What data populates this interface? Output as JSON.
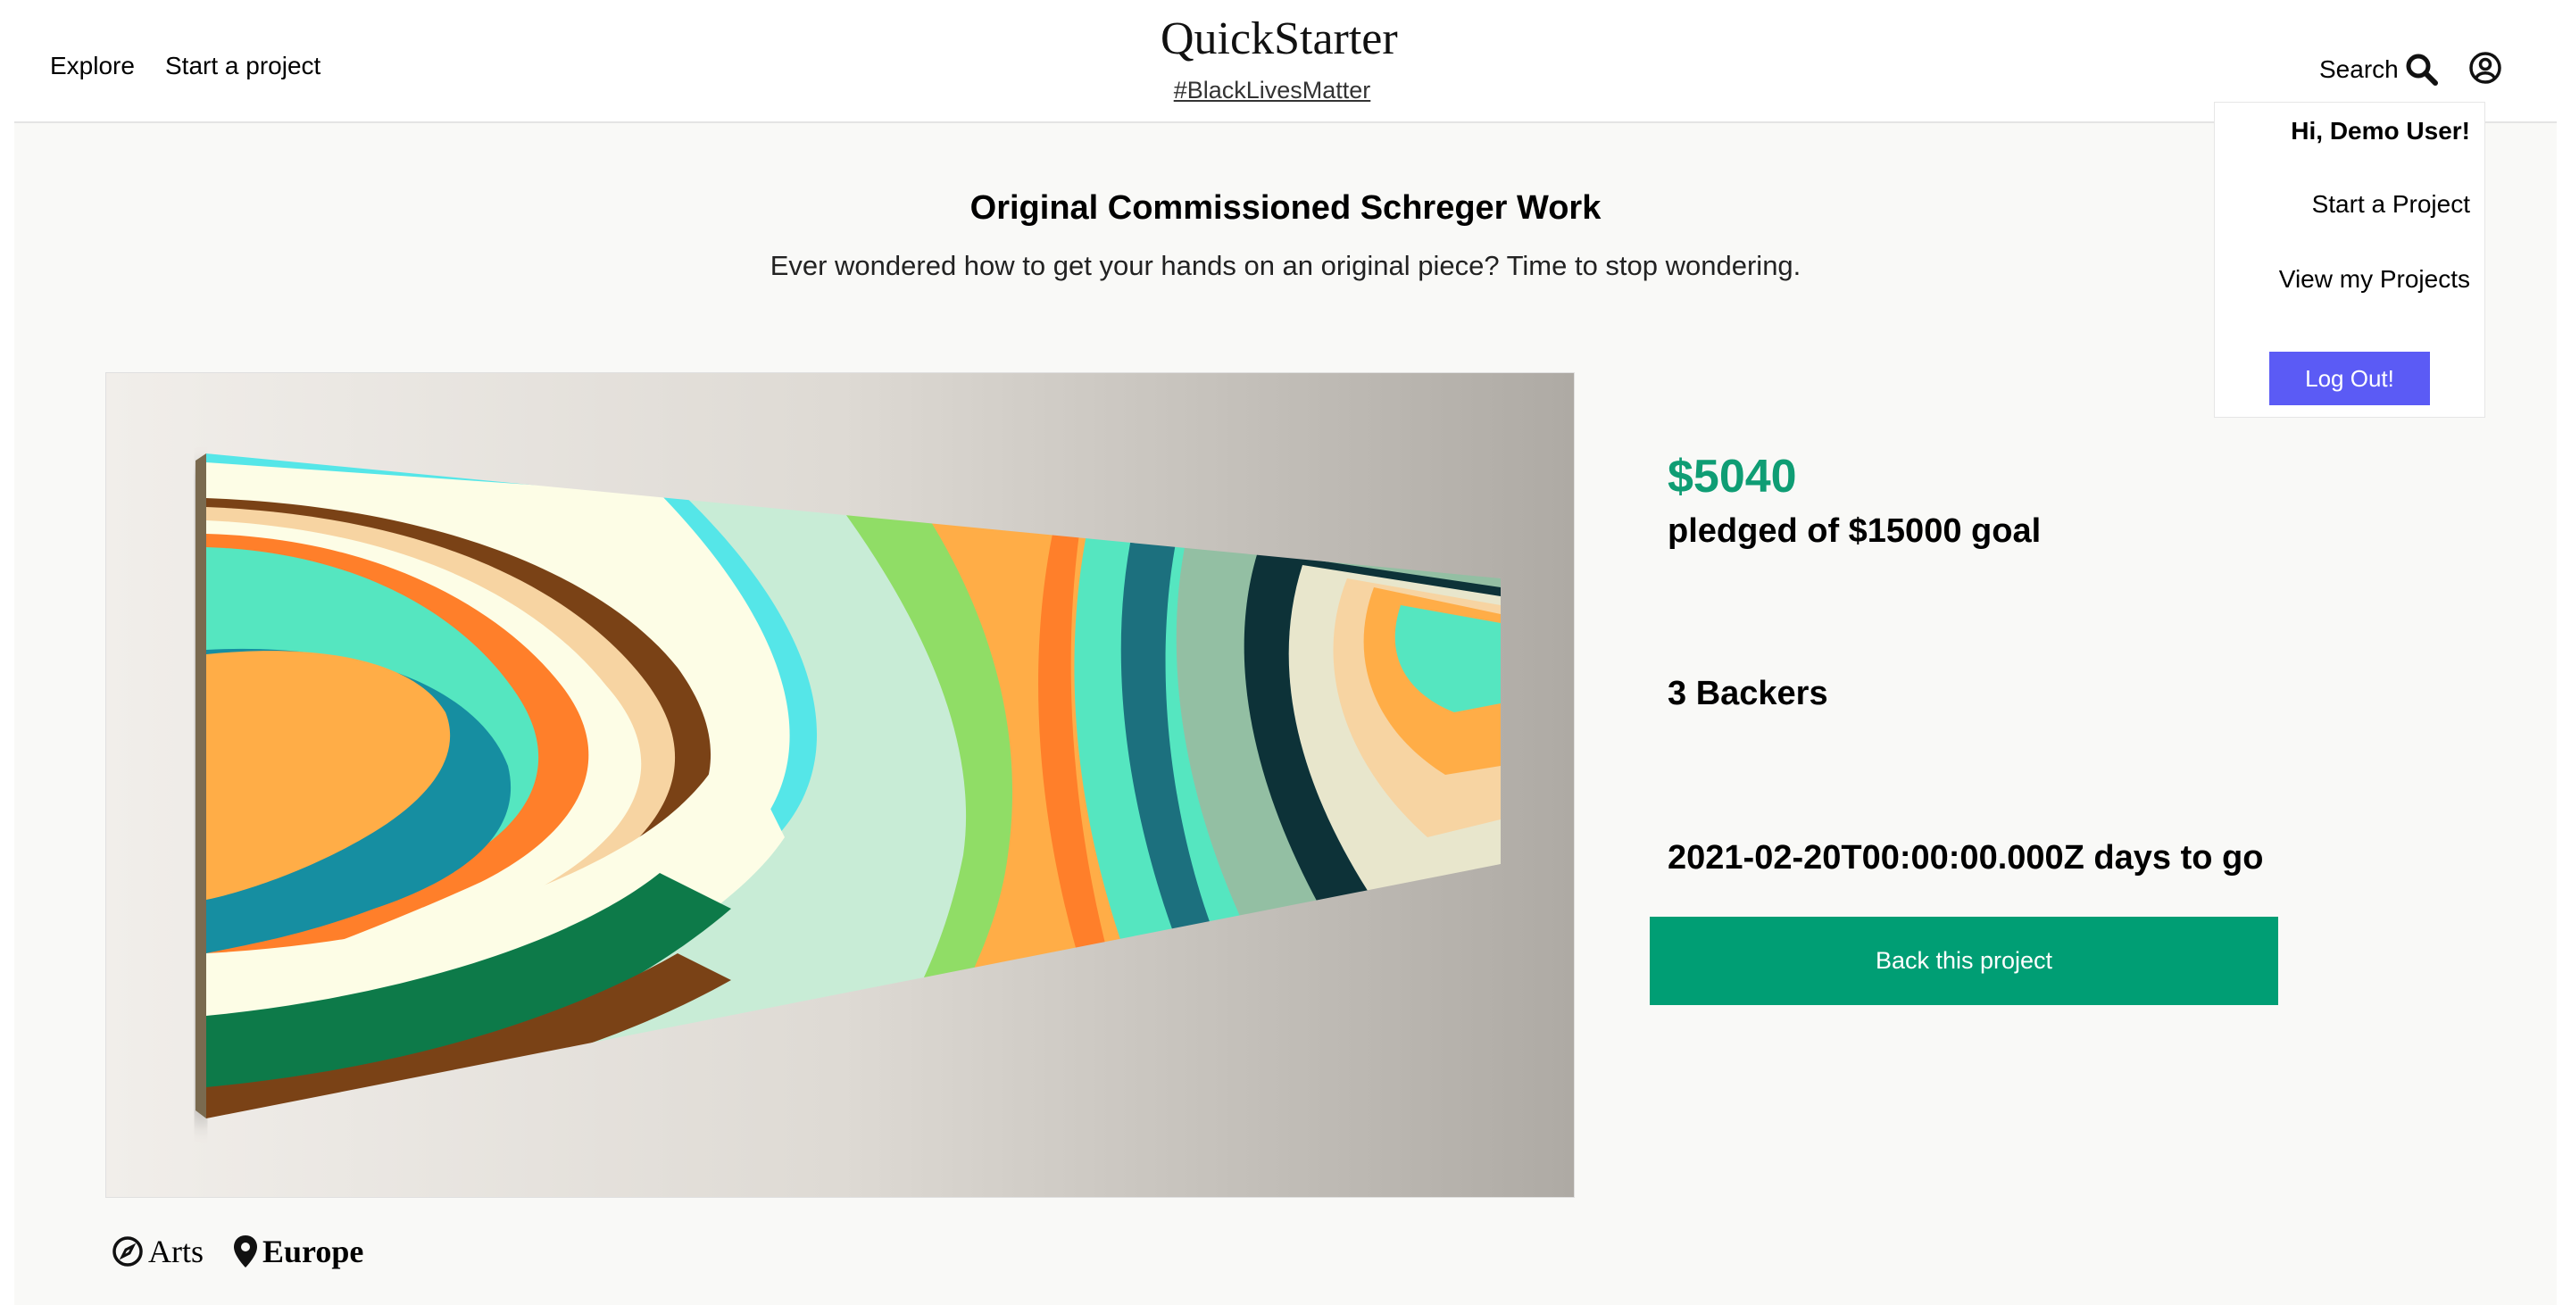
{
  "header": {
    "nav": {
      "explore": "Explore",
      "start": "Start a project"
    },
    "brand": "QuickStarter",
    "tagline": "#BlackLivesMatter",
    "search_label": "Search"
  },
  "project": {
    "title": "Original Commissioned Schreger Work",
    "blurb": "Ever wondered how to get your hands on an original piece? Time to stop wondering.",
    "pledged": "$5040",
    "goal_text": "pledged of $15000 goal",
    "backers_text": "3 Backers",
    "deadline_text": "2021-02-20T00:00:00.000Z days to go",
    "back_button": "Back this project",
    "category": "Arts",
    "location": "Europe"
  },
  "user_menu": {
    "greeting": "Hi, Demo User!",
    "start_project": "Start a Project",
    "view_projects": "View my Projects",
    "logout": "Log Out!"
  },
  "colors": {
    "accent_green": "#0f9d74",
    "button_green": "#009e74",
    "logout_purple": "#5b5bf5"
  },
  "icons": [
    "search-icon",
    "user-circle-icon",
    "compass-icon",
    "map-pin-icon"
  ]
}
